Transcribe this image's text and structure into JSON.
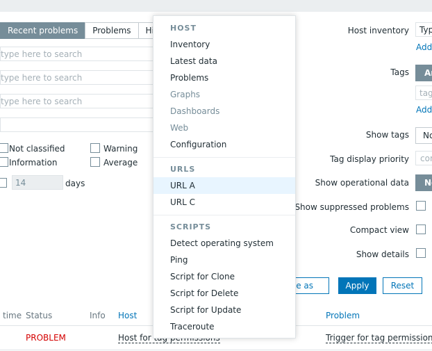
{
  "tabs": [
    {
      "label": "Recent problems"
    },
    {
      "label": "Problems"
    },
    {
      "label": "History"
    }
  ],
  "filter": {
    "search_placeholder": "type here to search",
    "severities": {
      "not_classified": "Not classified",
      "warning": "Warning",
      "information": "Information",
      "average": "Average"
    },
    "age_value": "14",
    "age_unit": "days",
    "host_inventory_label": "Host inventory",
    "host_inventory_value": "Typ",
    "add_label": "Add",
    "tags_label": "Tags",
    "tags_and_value": "An",
    "tag_placeholder": "tag",
    "show_tags_label": "Show tags",
    "show_tags_value": "No",
    "tag_priority_label": "Tag display priority",
    "tag_priority_placeholder": "com",
    "show_operational_label": "Show operational data",
    "show_operational_value": "No",
    "show_suppressed_label": "Show suppressed problems",
    "compact_view_label": "Compact view",
    "show_details_label": "Show details",
    "save_as_label": "e as",
    "apply_label": "Apply",
    "reset_label": "Reset"
  },
  "table": {
    "headers": {
      "time": "time",
      "status": "Status",
      "info": "Info",
      "host": "Host",
      "problem": "Problem"
    },
    "rows": [
      {
        "status": "PROBLEM",
        "host": "Host for tag permissions",
        "problem": "Trigger for tag permissions Ce"
      }
    ]
  },
  "menu": {
    "host_header": "HOST",
    "host_items": [
      {
        "label": "Inventory",
        "enabled": true
      },
      {
        "label": "Latest data",
        "enabled": true
      },
      {
        "label": "Problems",
        "enabled": true
      },
      {
        "label": "Graphs",
        "enabled": false
      },
      {
        "label": "Dashboards",
        "enabled": false
      },
      {
        "label": "Web",
        "enabled": false
      },
      {
        "label": "Configuration",
        "enabled": true
      }
    ],
    "urls_header": "URLS",
    "url_items": [
      {
        "label": "URL A",
        "hovered": true
      },
      {
        "label": "URL C",
        "hovered": false
      }
    ],
    "scripts_header": "SCRIPTS",
    "script_items": [
      {
        "label": "Detect operating system"
      },
      {
        "label": "Ping"
      },
      {
        "label": "Script for Clone"
      },
      {
        "label": "Script for Delete"
      },
      {
        "label": "Script for Update"
      },
      {
        "label": "Traceroute"
      }
    ]
  },
  "colors": {
    "accent": "#0275b8",
    "problem_red": "#d40000",
    "tab_active_bg": "#768d99"
  }
}
